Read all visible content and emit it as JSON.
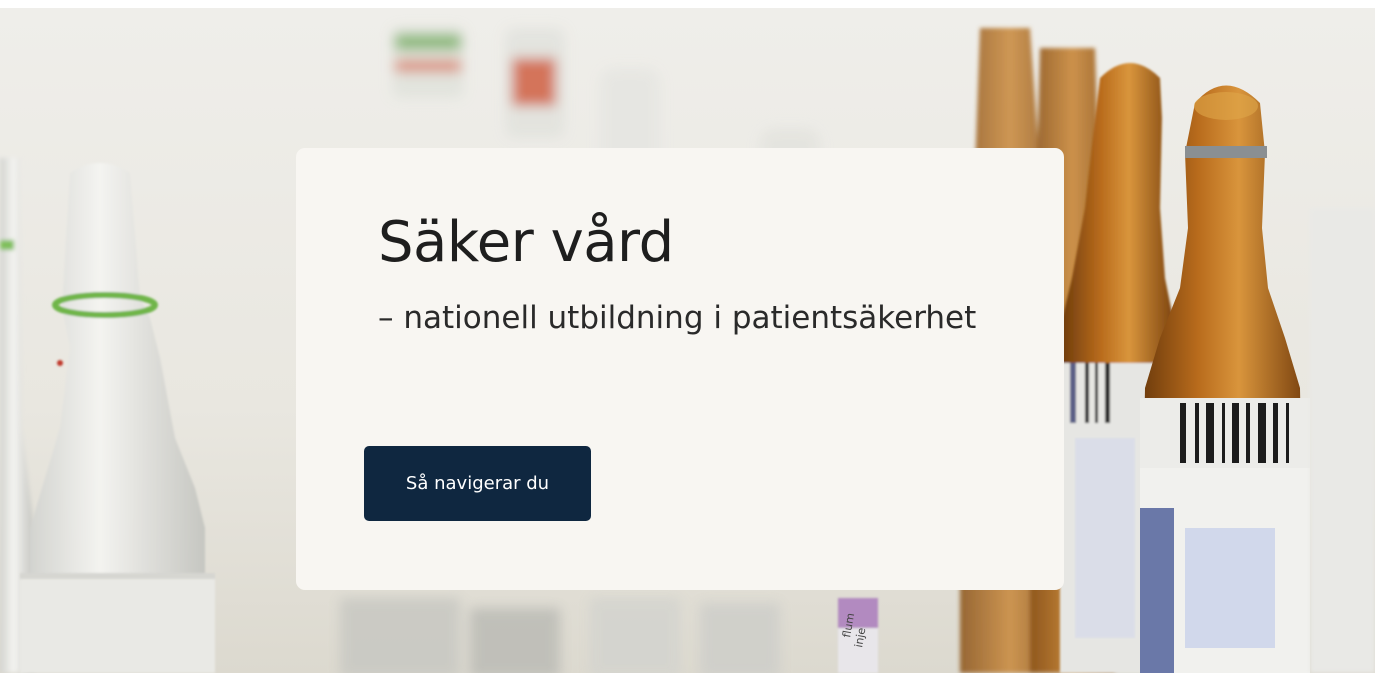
{
  "hero": {
    "title": "Säker vård",
    "subtitle": "– nationell utbildning i patientsäkerhet",
    "cta_label": "Så navigerar du",
    "colors": {
      "card_background": "#f8f6f2",
      "button_background": "#0f2740",
      "button_text": "#ffffff",
      "title_text": "#1e1e1e"
    }
  },
  "background_image": {
    "subject": "medicine ampoules",
    "label_fragments": [
      "flum",
      "inje"
    ]
  }
}
